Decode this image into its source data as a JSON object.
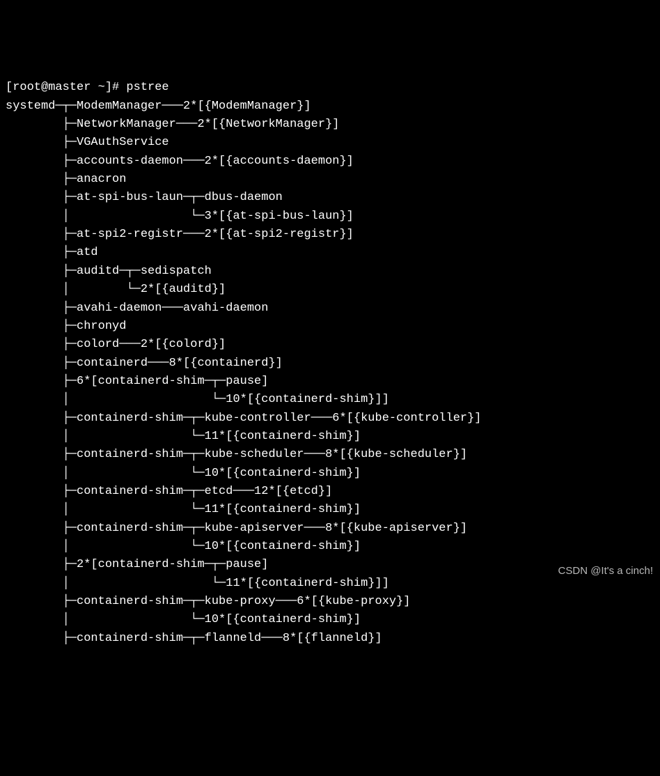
{
  "prompt": "[root@master ~]# pstree",
  "lines": [
    "systemd─┬─ModemManager───2*[{ModemManager}]",
    "        ├─NetworkManager───2*[{NetworkManager}]",
    "        ├─VGAuthService",
    "        ├─accounts-daemon───2*[{accounts-daemon}]",
    "        ├─anacron",
    "        ├─at-spi-bus-laun─┬─dbus-daemon",
    "        │                 └─3*[{at-spi-bus-laun}]",
    "        ├─at-spi2-registr───2*[{at-spi2-registr}]",
    "        ├─atd",
    "        ├─auditd─┬─sedispatch",
    "        │        └─2*[{auditd}]",
    "        ├─avahi-daemon───avahi-daemon",
    "        ├─chronyd",
    "        ├─colord───2*[{colord}]",
    "        ├─containerd───8*[{containerd}]",
    "        ├─6*[containerd-shim─┬─pause]",
    "        │                    └─10*[{containerd-shim}]]",
    "        ├─containerd-shim─┬─kube-controller───6*[{kube-controller}]",
    "        │                 └─11*[{containerd-shim}]",
    "        ├─containerd-shim─┬─kube-scheduler───8*[{kube-scheduler}]",
    "        │                 └─10*[{containerd-shim}]",
    "        ├─containerd-shim─┬─etcd───12*[{etcd}]",
    "        │                 └─11*[{containerd-shim}]",
    "        ├─containerd-shim─┬─kube-apiserver───8*[{kube-apiserver}]",
    "        │                 └─10*[{containerd-shim}]",
    "        ├─2*[containerd-shim─┬─pause]",
    "        │                    └─11*[{containerd-shim}]]",
    "        ├─containerd-shim─┬─kube-proxy───6*[{kube-proxy}]",
    "        │                 └─10*[{containerd-shim}]",
    "        ├─containerd-shim─┬─flanneld───8*[{flanneld}]"
  ],
  "watermark": "CSDN @It's a cinch!"
}
